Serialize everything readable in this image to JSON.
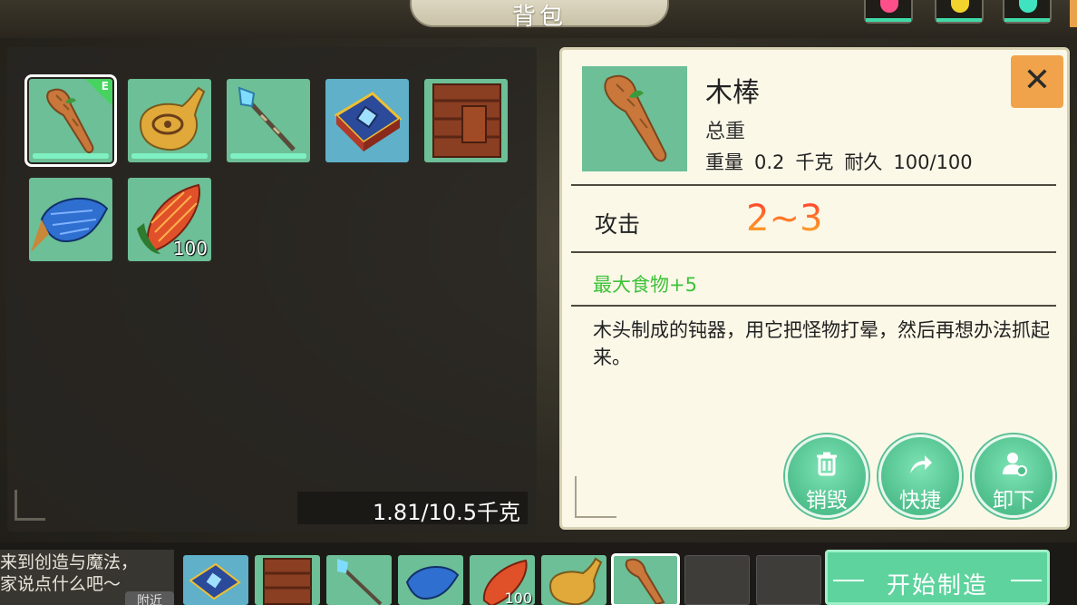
{
  "header": {
    "title": "背包"
  },
  "top_icons": [
    {
      "icon": "heart-icon",
      "color": "#ff4f8a"
    },
    {
      "icon": "coin-icon",
      "color": "#f2d22c"
    },
    {
      "icon": "cup-icon",
      "color": "#3fe3c0"
    }
  ],
  "inventory": {
    "slots": [
      {
        "name": "wooden-club",
        "selected": true,
        "equipped": true,
        "equip_mark": "E",
        "durability": 1.0
      },
      {
        "name": "gourd",
        "durability": 1.0
      },
      {
        "name": "crystal-staff",
        "durability": 1.0
      },
      {
        "name": "magic-book"
      },
      {
        "name": "wooden-crate"
      },
      {
        "name": "blue-fish"
      },
      {
        "name": "corn",
        "count": "100"
      }
    ],
    "weight": "1.81/10.5千克"
  },
  "detail": {
    "name": "木棒",
    "subtitle": "总重",
    "weight_label": "重量",
    "weight_value": "0.2",
    "weight_unit": "千克",
    "durability_label": "耐久",
    "durability_value": "100/100",
    "close_symbol": "✕",
    "attack_label": "攻击",
    "attack_value": "2~3",
    "bonus": "最大食物+5",
    "description": "木头制成的钝器，用它把怪物打晕，然后再想办法抓起来。",
    "actions": [
      {
        "icon": "trash-icon",
        "label": "销毁"
      },
      {
        "icon": "share-icon",
        "label": "快捷"
      },
      {
        "icon": "unequip-user-icon",
        "label": "卸下"
      }
    ]
  },
  "chat": {
    "lines": [
      "来到创造与魔法，",
      "家说点什么吧～"
    ],
    "tab": "附近"
  },
  "hotbar": [
    {
      "name": "magic-book"
    },
    {
      "name": "wooden-crate"
    },
    {
      "name": "crystal-staff"
    },
    {
      "name": "blue-fish"
    },
    {
      "name": "corn",
      "count": "100"
    },
    {
      "name": "gourd"
    },
    {
      "name": "wooden-club",
      "active": true
    },
    {
      "name": "empty"
    },
    {
      "name": "empty"
    }
  ],
  "craft_button": "开始制造",
  "colors": {
    "slot_bg": "#6cbf96",
    "accent_green": "#5fd39e",
    "close_orange": "#f0a34a",
    "bonus_green": "#3fc23a"
  }
}
